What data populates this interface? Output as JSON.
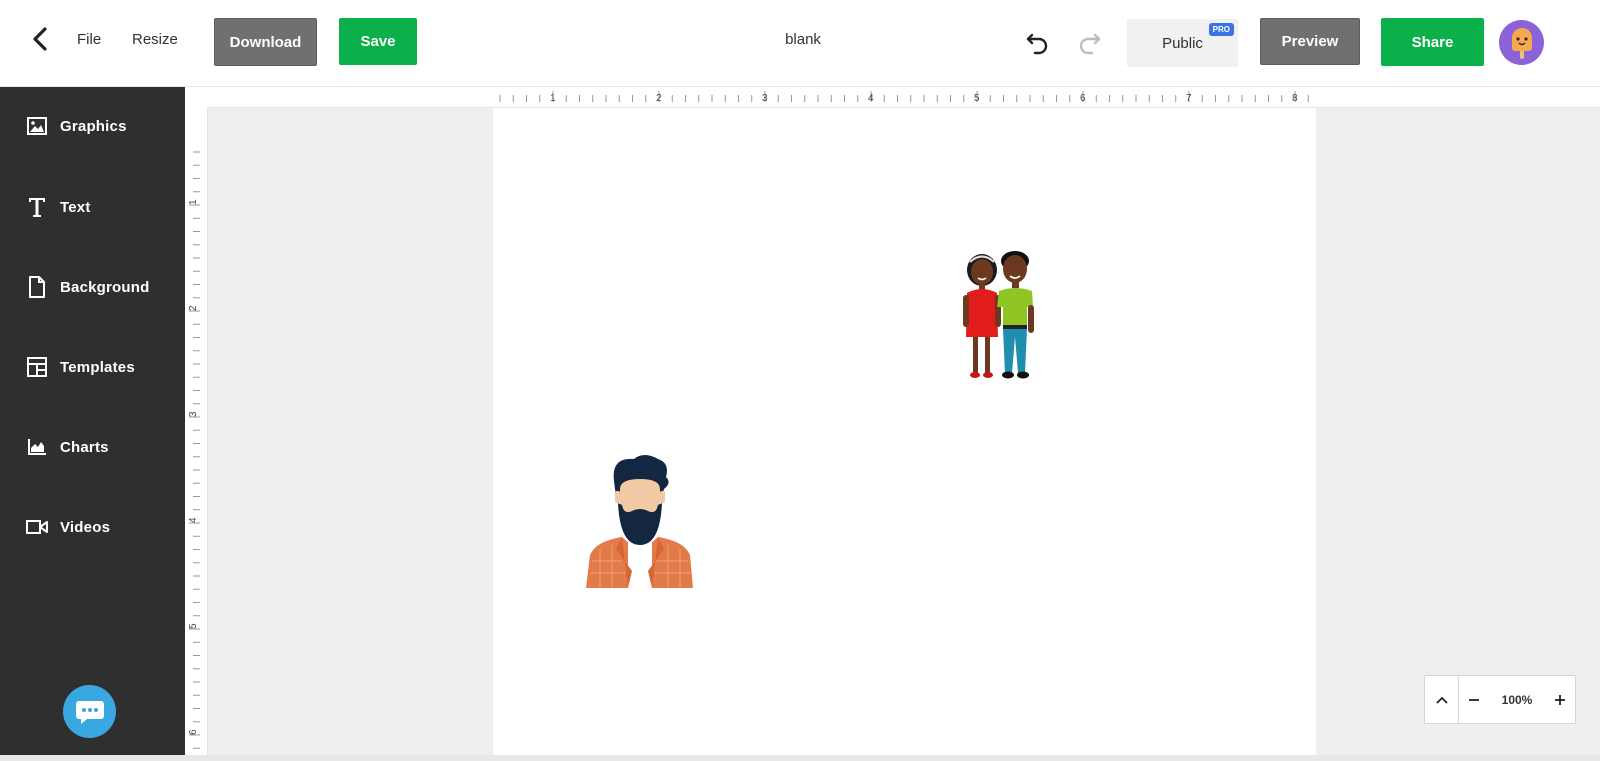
{
  "header": {
    "file_label": "File",
    "resize_label": "Resize",
    "download_label": "Download",
    "save_label": "Save",
    "doc_title": "blank",
    "visibility_label": "Public",
    "pro_badge": "PRO",
    "preview_label": "Preview",
    "share_label": "Share"
  },
  "sidebar": {
    "items": [
      {
        "label": "Graphics",
        "icon": "image-icon"
      },
      {
        "label": "Text",
        "icon": "text-t-icon"
      },
      {
        "label": "Background",
        "icon": "document-icon"
      },
      {
        "label": "Templates",
        "icon": "layout-icon"
      },
      {
        "label": "Charts",
        "icon": "area-chart-icon"
      },
      {
        "label": "Videos",
        "icon": "video-camera-icon"
      }
    ]
  },
  "rulers": {
    "horizontal_labels": [
      "1",
      "2",
      "3",
      "4",
      "5",
      "6",
      "7",
      "8"
    ],
    "vertical_labels": [
      "1",
      "2",
      "3",
      "4",
      "5",
      "6"
    ]
  },
  "zoom": {
    "value": "100%"
  },
  "colors": {
    "green": "#0bb04b",
    "gray_button": "#707070",
    "sidebar_bg": "#2f2f2f",
    "avatar_bg": "#8b62d8",
    "chat_bg": "#3aa8e0",
    "pro_badge": "#3b73e0"
  }
}
